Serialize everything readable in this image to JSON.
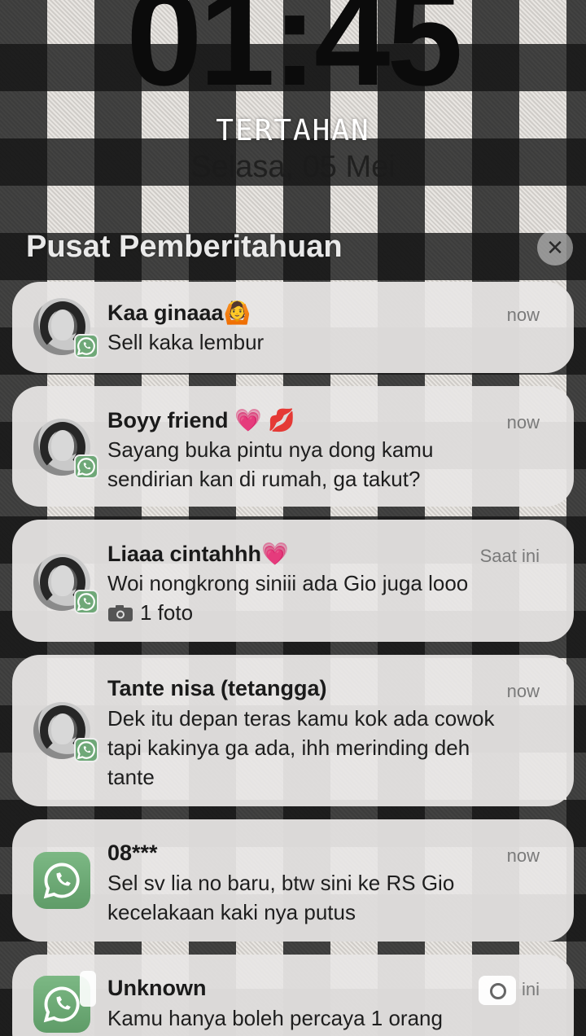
{
  "lock_screen": {
    "time": "01:45",
    "status": "TERTAHAN",
    "date": "Selasa, 05 Mei"
  },
  "notification_center": {
    "header": "Pusat Pemberitahuan",
    "close_symbol": "✕"
  },
  "notifications": [
    {
      "sender": "Kaa ginaaa",
      "emoji": "🙆",
      "time": "now",
      "message": "Sell kaka lembur",
      "icon": "contact-avatar",
      "app": "WhatsApp"
    },
    {
      "sender": "Boyy friend",
      "emoji": "💗 💋",
      "time": "now",
      "message": "Sayang buka pintu nya dong kamu sendirian kan di rumah, ga takut?",
      "icon": "contact-avatar",
      "app": "WhatsApp"
    },
    {
      "sender": "Liaaa cintahhh",
      "emoji": "💗",
      "time": "Saat ini",
      "message": "Woi nongkrong siniii ada Gio juga looo",
      "attachment": "1 foto",
      "icon": "contact-avatar",
      "app": "WhatsApp"
    },
    {
      "sender": "Tante nisa (tetangga)",
      "emoji": "",
      "time": "now",
      "message": "Dek itu depan teras kamu kok ada cowok tapi kakinya ga ada, ihh merinding deh tante",
      "icon": "contact-avatar",
      "app": "WhatsApp"
    },
    {
      "sender": "08***",
      "emoji": "",
      "time": "now",
      "message": "Sel sv lia no baru, btw sini ke RS Gio kecelakaan kaki nya putus",
      "icon": "whatsapp-app-icon",
      "app": "WhatsApp"
    },
    {
      "sender": "Unknown",
      "emoji": "",
      "time": "ini",
      "message": "Kamu hanya boleh percaya 1 orang",
      "icon": "whatsapp-app-icon",
      "app": "WhatsApp"
    }
  ],
  "colors": {
    "whatsapp_green": "#6fa878",
    "card_bg": "#e8e6e4",
    "time_text": "#7a7a7a"
  }
}
